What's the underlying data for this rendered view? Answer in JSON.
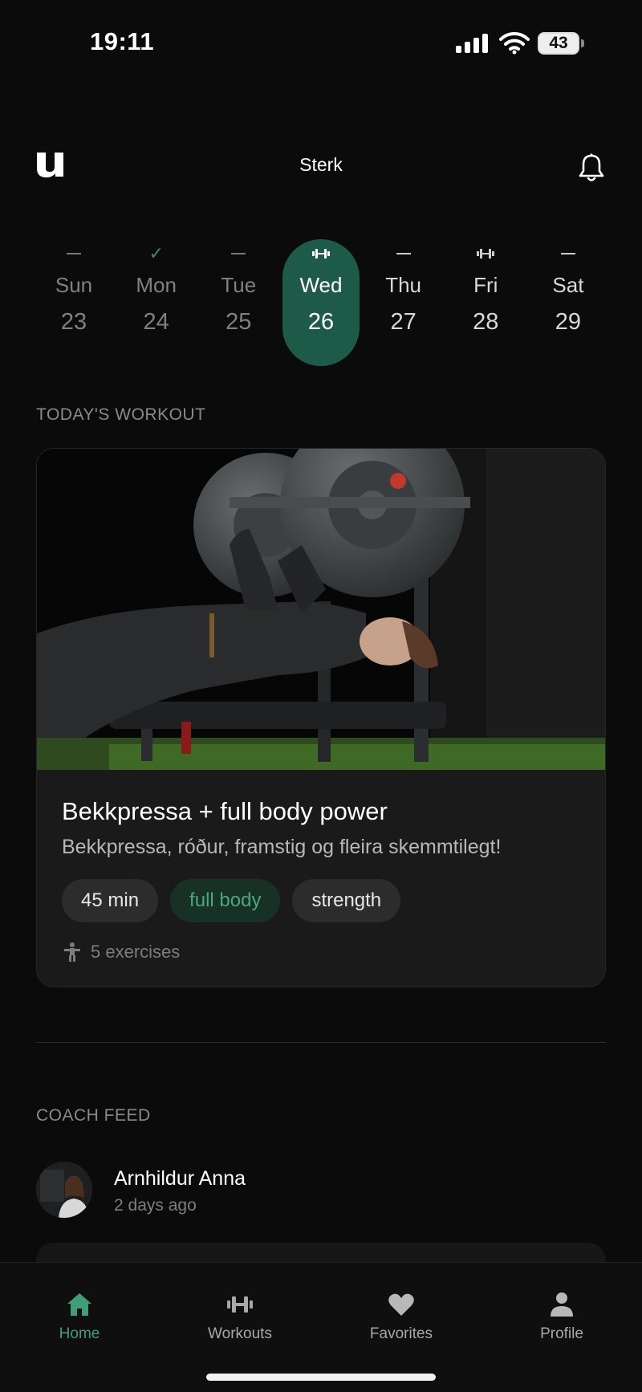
{
  "status_bar": {
    "time": "19:11",
    "battery": "43"
  },
  "header": {
    "title": "Sterk",
    "logo_icon": "u-logo-icon",
    "bell_icon": "bell-icon"
  },
  "week": [
    {
      "name": "Sun",
      "num": "23",
      "state": "past",
      "mark": "dash"
    },
    {
      "name": "Mon",
      "num": "24",
      "state": "past",
      "mark": "check"
    },
    {
      "name": "Tue",
      "num": "25",
      "state": "past",
      "mark": "dash"
    },
    {
      "name": "Wed",
      "num": "26",
      "state": "active",
      "mark": "dumbbell"
    },
    {
      "name": "Thu",
      "num": "27",
      "state": "future",
      "mark": "dash"
    },
    {
      "name": "Fri",
      "num": "28",
      "state": "future",
      "mark": "dumbbell"
    },
    {
      "name": "Sat",
      "num": "29",
      "state": "future",
      "mark": "dash"
    }
  ],
  "todays_workout": {
    "section_label": "TODAY'S WORKOUT",
    "title": "Bekkpressa + full body power",
    "subtitle": "Bekkpressa, róður, framstig og fleira skemmtilegt!",
    "tags": [
      {
        "label": "45 min",
        "style": "neutral"
      },
      {
        "label": "full body",
        "style": "green"
      },
      {
        "label": "strength",
        "style": "neutral"
      }
    ],
    "exercises": "5 exercises"
  },
  "coach_feed": {
    "section_label": "COACH FEED",
    "coach_name": "Arnhildur Anna",
    "posted": "2 days ago"
  },
  "tabs": [
    {
      "label": "Home",
      "icon": "home-icon",
      "active": true
    },
    {
      "label": "Workouts",
      "icon": "dumbbell-icon",
      "active": false
    },
    {
      "label": "Favorites",
      "icon": "heart-icon",
      "active": false
    },
    {
      "label": "Profile",
      "icon": "person-icon",
      "active": false
    }
  ],
  "colors": {
    "accent": "#1e5a48",
    "accent_text": "#3f9e7a",
    "background": "#0b0b0b",
    "card": "#1a1a1a"
  }
}
